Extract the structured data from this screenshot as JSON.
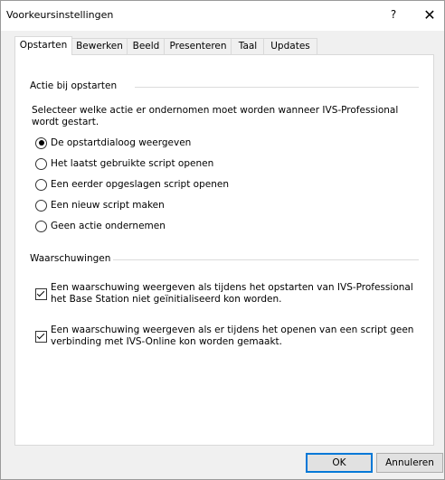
{
  "window": {
    "title": "Voorkeursinstellingen",
    "help_label": "?",
    "close_label": "✕"
  },
  "tabs": [
    {
      "label": "Opstarten",
      "active": true
    },
    {
      "label": "Bewerken",
      "active": false
    },
    {
      "label": "Beeld",
      "active": false
    },
    {
      "label": "Presenteren",
      "active": false
    },
    {
      "label": "Taal",
      "active": false
    },
    {
      "label": "Updates",
      "active": false
    }
  ],
  "startup_group": {
    "header": "Actie bij opstarten",
    "description": "Selecteer welke actie er ondernomen moet worden wanneer IVS-Professional wordt gestart.",
    "options": [
      {
        "label": "De opstartdialoog weergeven",
        "checked": true
      },
      {
        "label": "Het laatst gebruikte script openen",
        "checked": false
      },
      {
        "label": "Een eerder opgeslagen script openen",
        "checked": false
      },
      {
        "label": "Een nieuw script maken",
        "checked": false
      },
      {
        "label": "Geen actie ondernemen",
        "checked": false
      }
    ]
  },
  "warnings_group": {
    "header": "Waarschuwingen",
    "items": [
      {
        "label": "Een waarschuwing weergeven als tijdens het opstarten van IVS-Professional het Base Station niet geïnitialiseerd kon worden.",
        "checked": true
      },
      {
        "label": "Een waarschuwing weergeven als er tijdens het openen van een script geen verbinding met IVS-Online kon worden gemaakt.",
        "checked": true
      }
    ]
  },
  "buttons": {
    "ok_label": "OK",
    "cancel_label": "Annuleren"
  }
}
